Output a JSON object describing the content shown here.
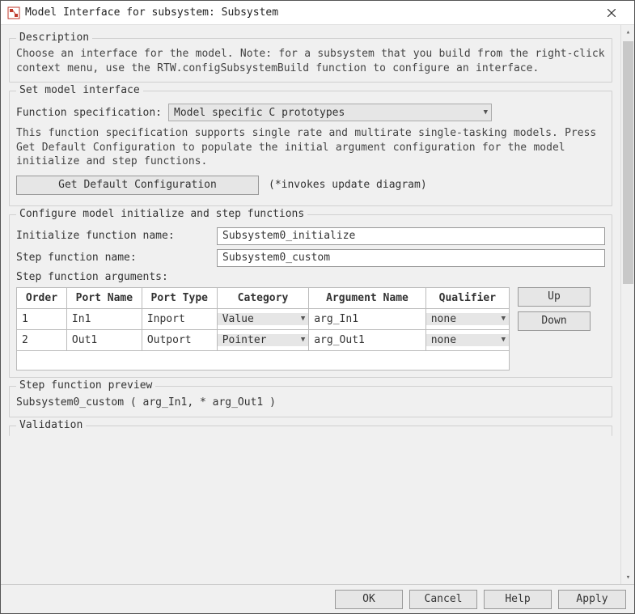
{
  "window": {
    "title": "Model Interface for subsystem: Subsystem"
  },
  "description": {
    "legend": "Description",
    "text": "Choose an interface for the model. Note: for a subsystem that you build from the right-click context menu, use the RTW.configSubsystemBuild function to configure an interface."
  },
  "set_interface": {
    "legend": "Set model interface",
    "func_spec_label": "Function specification:",
    "func_spec_value": "Model specific C prototypes",
    "info": "This function specification supports single rate and multirate single-tasking models. Press Get Default Configuration to populate the initial argument configuration for the model initialize and step functions.",
    "get_default_btn": "Get Default Configuration",
    "invoke_note": "(*invokes update diagram)"
  },
  "configure": {
    "legend": "Configure model initialize and step functions",
    "init_label": "Initialize function name:",
    "init_value": "Subsystem0_initialize",
    "step_label": "Step function name:",
    "step_value": "Subsystem0_custom",
    "args_label": "Step function arguments:",
    "headers": {
      "order": "Order",
      "port_name": "Port Name",
      "port_type": "Port Type",
      "category": "Category",
      "arg_name": "Argument Name",
      "qualifier": "Qualifier"
    },
    "rows": [
      {
        "order": "1",
        "port_name": "In1",
        "port_type": "Inport",
        "category": "Value",
        "arg_name": "arg_In1",
        "qualifier": "none"
      },
      {
        "order": "2",
        "port_name": "Out1",
        "port_type": "Outport",
        "category": "Pointer",
        "arg_name": "arg_Out1",
        "qualifier": "none"
      }
    ],
    "up_btn": "Up",
    "down_btn": "Down"
  },
  "preview": {
    "legend": "Step function preview",
    "text": "Subsystem0_custom ( arg_In1, * arg_Out1 )"
  },
  "validation": {
    "legend": "Validation"
  },
  "footer": {
    "ok": "OK",
    "cancel": "Cancel",
    "help": "Help",
    "apply": "Apply"
  }
}
